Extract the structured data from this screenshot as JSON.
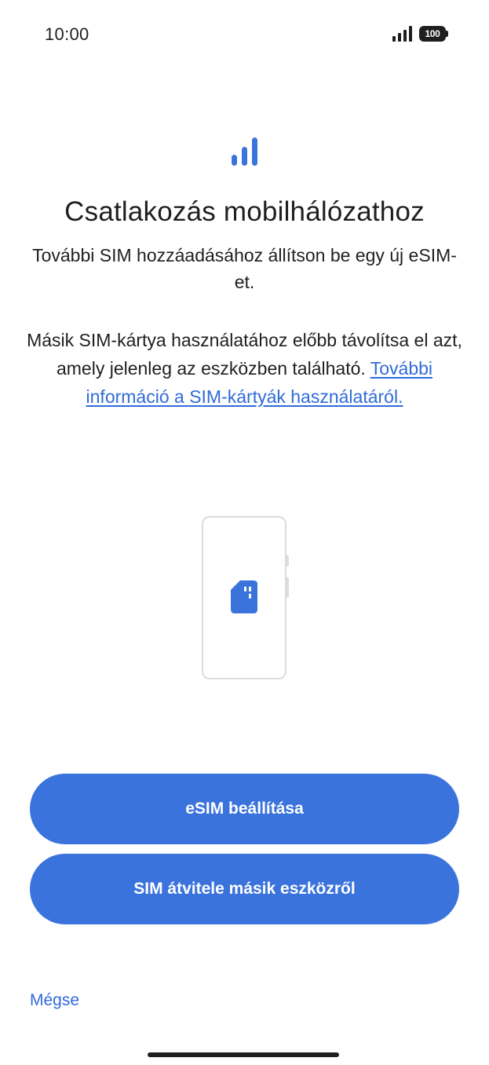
{
  "status_bar": {
    "time": "10:00",
    "battery_level": "100",
    "signal_icon": "signal-bars-icon"
  },
  "header": {
    "icon": "signal-bars-icon",
    "accent_color": "#3b73dd",
    "title": "Csatlakozás mobilhálózathoz",
    "subtitle": "További SIM hozzáadásához állítson be egy új eSIM-et."
  },
  "body": {
    "text": "Másik SIM-kártya használatához előbb távolítsa el azt, amely jelenleg az eszközben található.",
    "link_text": "További információ a SIM-kártyák használatáról."
  },
  "illustration": {
    "icon": "sim-card-icon"
  },
  "actions": {
    "setup_esim_label": "eSIM beállítása",
    "transfer_sim_label": "SIM átvitele másik eszközről",
    "cancel_label": "Mégse"
  },
  "colors": {
    "primary": "#3b73dd",
    "link": "#2f6bd8",
    "text": "#1f1f1f"
  }
}
